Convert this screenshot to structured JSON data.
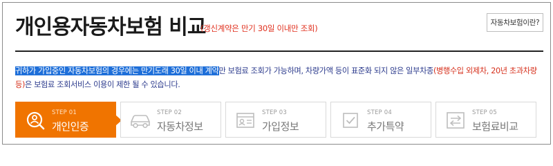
{
  "header": {
    "title": "개인용자동차보험 비교",
    "subtitle": "(갱신계약은 만기 30일 이내만 조회)",
    "help_button": "자동차보험이란?"
  },
  "notice": {
    "highlighted": "귀하가 가입중인 자동차보험의 경우에는 만기도래 30일 이내 계약",
    "text_before_red": "만 보험료 조회가 가능하며, 차량가액 등이 표준화 되지 않은 일부차종",
    "red": "(병행수입 외제차, 20년 초과차량 등)",
    "text_after_red": "은 보험료 조회서비스 이용이 제한 될 수 있습니다."
  },
  "steps": [
    {
      "small": "STEP 01",
      "label": "개인인증",
      "icon": "search-person-icon",
      "active": true
    },
    {
      "small": "STEP 02",
      "label": "자동차정보",
      "icon": "car-icon",
      "active": false
    },
    {
      "small": "STEP 03",
      "label": "가입정보",
      "icon": "id-card-icon",
      "active": false
    },
    {
      "small": "STEP 04",
      "label": "추가특약",
      "icon": "checkbox-icon",
      "active": false
    },
    {
      "small": "STEP 05",
      "label": "보험료비교",
      "icon": "compare-arrows-icon",
      "active": false
    }
  ],
  "colors": {
    "accent": "#f07400",
    "red_text": "#e0301e",
    "notice_text": "#2b3a8c",
    "highlight": "#1e6fd9"
  }
}
